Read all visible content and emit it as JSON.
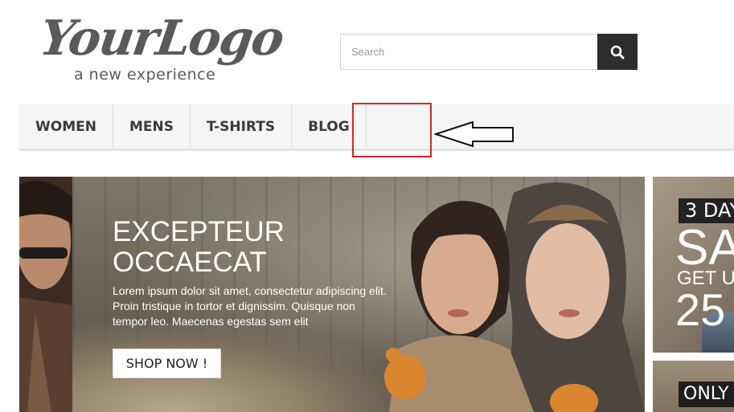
{
  "logo": {
    "main": "YourLogo",
    "tagline": "a new experience"
  },
  "search": {
    "placeholder": "Search",
    "icon": "search-icon"
  },
  "nav": {
    "items": [
      "WOMEN",
      "MENS",
      "T-SHIRTS",
      "BLOG"
    ]
  },
  "annotation": {
    "box_color": "#d9232e",
    "arrow_icon": "left-arrow-icon"
  },
  "banner": {
    "title_line1": "EXCEPTEUR",
    "title_line2": "OCCAECAT",
    "text": "Lorem ipsum dolor sit amet, consectetur adipiscing elit. Proin tristique in tortor et dignissim. Quisque non tempor leo. Maecenas egestas sem elit",
    "button": "SHOP NOW !"
  },
  "side_banner_1": {
    "tag": "3 DAY",
    "big": "SA",
    "sub": "GET U",
    "percent": "25"
  },
  "side_banner_2": {
    "tag": "ONLY"
  },
  "colors": {
    "nav_bg": "#f5f5f5",
    "search_button": "#2d2d2d",
    "highlight": "#d9232e"
  }
}
